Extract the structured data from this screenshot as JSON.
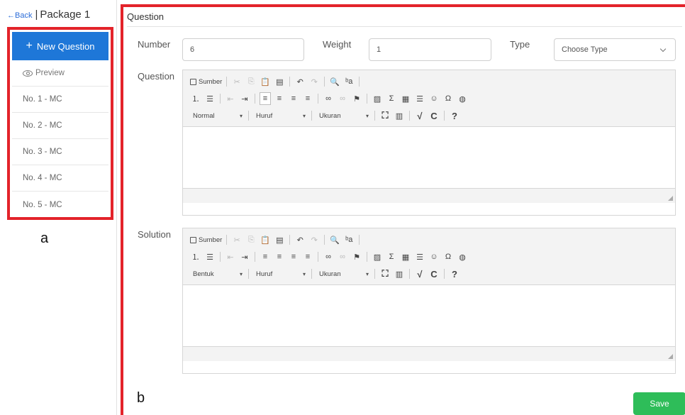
{
  "header": {
    "back_label": "←Back",
    "separator": "|",
    "package_title": "Package 1"
  },
  "sidebar": {
    "new_question_label": "New Question",
    "preview_label": "Preview",
    "items": [
      {
        "label": "No. 1 - MC"
      },
      {
        "label": "No. 2 - MC"
      },
      {
        "label": "No. 3 - MC"
      },
      {
        "label": "No. 4 - MC"
      },
      {
        "label": "No. 5 - MC"
      }
    ]
  },
  "annotations": {
    "a": "a",
    "b": "b"
  },
  "main": {
    "title": "Question",
    "number": {
      "label": "Number",
      "value": "6"
    },
    "weight": {
      "label": "Weight",
      "value": "1"
    },
    "type": {
      "label": "Type",
      "placeholder": "Choose Type"
    },
    "question_editor": {
      "label": "Question",
      "source_label": "Sumber",
      "format_combo": "Normal",
      "font_combo": "Huruf",
      "size_combo": "Ukuran"
    },
    "solution_editor": {
      "label": "Solution",
      "source_label": "Sumber",
      "format_combo": "Bentuk",
      "font_combo": "Huruf",
      "size_combo": "Ukuran"
    },
    "save_label": "Save"
  },
  "colors": {
    "accent": "#1e77d8",
    "save": "#2ebd59",
    "highlight_border": "#e3232a"
  }
}
